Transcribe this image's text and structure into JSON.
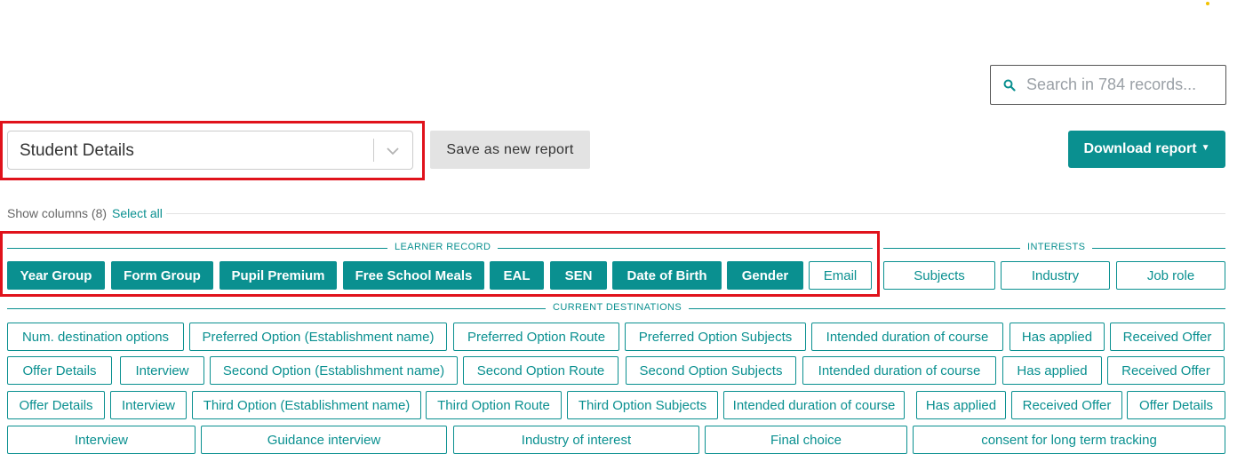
{
  "search": {
    "placeholder": "Search in 784 records..."
  },
  "report_select": {
    "value": "Student Details"
  },
  "buttons": {
    "save_as_new": "Save as new report",
    "download": "Download report"
  },
  "show_columns": {
    "label": "Show columns (8)",
    "select_all": "Select all"
  },
  "groups": {
    "learner_record": {
      "title": "LEARNER RECORD",
      "chips": [
        {
          "label": "Year Group",
          "selected": true
        },
        {
          "label": "Form Group",
          "selected": true
        },
        {
          "label": "Pupil Premium",
          "selected": true
        },
        {
          "label": "Free School Meals",
          "selected": true
        },
        {
          "label": "EAL",
          "selected": true
        },
        {
          "label": "SEN",
          "selected": true
        },
        {
          "label": "Date of Birth",
          "selected": true
        },
        {
          "label": "Gender",
          "selected": true
        },
        {
          "label": "Email",
          "selected": false
        }
      ]
    },
    "interests": {
      "title": "INTERESTS",
      "chips": [
        {
          "label": "Subjects",
          "selected": false
        },
        {
          "label": "Industry",
          "selected": false
        },
        {
          "label": "Job role",
          "selected": false
        }
      ]
    },
    "current_destinations": {
      "title": "CURRENT DESTINATIONS",
      "rows": [
        [
          "Num. destination options",
          "Preferred Option (Establishment name)",
          "Preferred Option Route",
          "Preferred Option Subjects",
          "Intended duration of course",
          "Has applied",
          "Received Offer"
        ],
        [
          "Offer Details",
          "Interview",
          "Second Option (Establishment name)",
          "Second Option Route",
          "Second Option Subjects",
          "Intended duration of course",
          "Has applied",
          "Received Offer"
        ],
        [
          "Offer Details",
          "Interview",
          "Third Option (Establishment name)",
          "Third Option Route",
          "Third Option Subjects",
          "Intended duration of course",
          "Has applied",
          "Received Offer",
          "Offer Details"
        ],
        [
          "Interview",
          "Guidance interview",
          "Industry of interest",
          "Final choice",
          "consent for long term tracking"
        ]
      ]
    }
  },
  "colors": {
    "accent": "#0a9090",
    "highlight": "#e0121b",
    "save_bg": "#e3e3e3"
  }
}
